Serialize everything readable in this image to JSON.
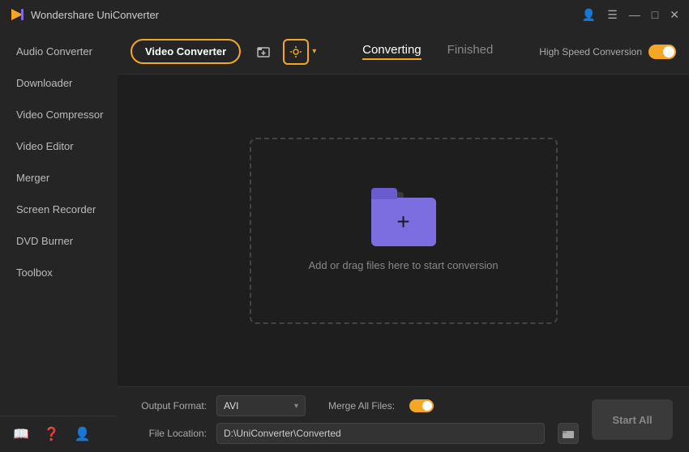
{
  "app": {
    "title": "Wondershare UniConverter",
    "logo": "🎬"
  },
  "titlebar": {
    "controls": {
      "account": "👤",
      "menu": "☰",
      "minimize": "—",
      "maximize": "□",
      "close": "✕"
    }
  },
  "toolbar": {
    "video_converter_label": "Video Converter",
    "add_icon_label": "+",
    "tabs": [
      {
        "label": "Converting",
        "active": true
      },
      {
        "label": "Finished",
        "active": false
      }
    ],
    "high_speed_label": "High Speed Conversion"
  },
  "sidebar": {
    "items": [
      {
        "label": "Audio Converter",
        "active": false
      },
      {
        "label": "Downloader",
        "active": false
      },
      {
        "label": "Video Compressor",
        "active": false
      },
      {
        "label": "Video Editor",
        "active": false
      },
      {
        "label": "Merger",
        "active": false
      },
      {
        "label": "Screen Recorder",
        "active": false
      },
      {
        "label": "DVD Burner",
        "active": false
      },
      {
        "label": "Toolbox",
        "active": false
      }
    ],
    "footer_icons": {
      "book": "📖",
      "help": "❓",
      "user": "👤"
    }
  },
  "drop_zone": {
    "text": "Add or drag files here to start conversion"
  },
  "bottom_bar": {
    "output_format_label": "Output Format:",
    "format_value": "AVI",
    "merge_label": "Merge All Files:",
    "file_location_label": "File Location:",
    "file_location_value": "D:\\UniConverter\\Converted",
    "start_all_label": "Start All"
  }
}
